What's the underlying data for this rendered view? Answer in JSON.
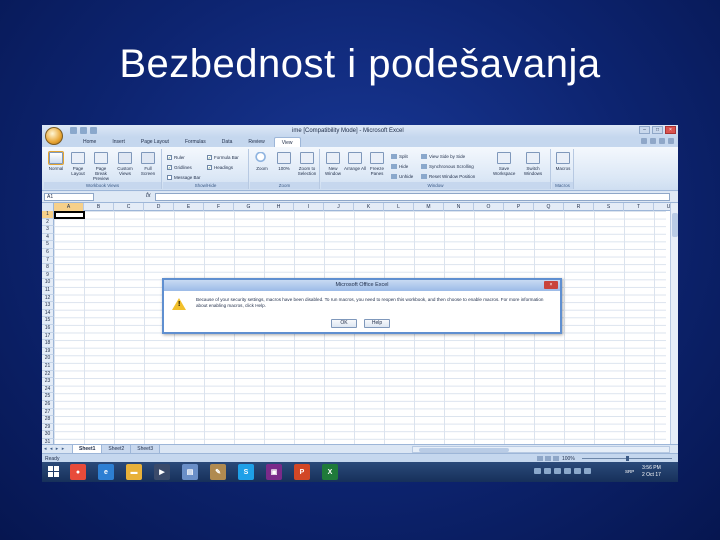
{
  "slide": {
    "title": "Bezbednost i podešavanja"
  },
  "window": {
    "title": "ime  [Compatibility Mode]  -  Microsoft Excel",
    "controls": [
      "–",
      "□",
      "×"
    ]
  },
  "ribbon": {
    "tabs": [
      {
        "label": "Home"
      },
      {
        "label": "Insert"
      },
      {
        "label": "Page Layout"
      },
      {
        "label": "Formulas"
      },
      {
        "label": "Data"
      },
      {
        "label": "Review"
      },
      {
        "label": "View",
        "active": true
      }
    ],
    "groups": {
      "workbook_views": {
        "label": "Workbook Views",
        "buttons": [
          "Normal",
          "Page Layout",
          "Page Break Preview",
          "Custom Views",
          "Full Screen"
        ]
      },
      "show_hide": {
        "label": "Show/Hide",
        "checks": [
          {
            "label": "Ruler",
            "checked": true
          },
          {
            "label": "Gridlines",
            "checked": true
          },
          {
            "label": "Message Bar",
            "checked": false
          },
          {
            "label": "Formula Bar",
            "checked": true
          },
          {
            "label": "Headings",
            "checked": true
          }
        ]
      },
      "zoom": {
        "label": "Zoom",
        "buttons": [
          "Zoom",
          "100%",
          "Zoom to Selection"
        ]
      },
      "window": {
        "label": "Window",
        "buttons": [
          "New Window",
          "Arrange All",
          "Freeze Panes"
        ],
        "small": [
          "Split",
          "Hide",
          "Unhide",
          "View Side by Side",
          "Synchronous Scrolling",
          "Reset Window Position"
        ],
        "big": [
          "Save Workspace",
          "Switch Windows"
        ]
      },
      "macros": {
        "label": "Macros",
        "buttons": [
          "Macros"
        ]
      }
    }
  },
  "formula_bar": {
    "name_box": "A1",
    "fx": "fx",
    "value": ""
  },
  "grid": {
    "columns": [
      "A",
      "B",
      "C",
      "D",
      "E",
      "F",
      "G",
      "H",
      "I",
      "J",
      "K",
      "L",
      "M",
      "N",
      "O",
      "P",
      "Q",
      "R",
      "S",
      "T",
      "U"
    ],
    "rows": [
      "1",
      "2",
      "3",
      "4",
      "5",
      "6",
      "7",
      "8",
      "9",
      "10",
      "11",
      "12",
      "13",
      "14",
      "15",
      "16",
      "17",
      "18",
      "19",
      "20",
      "21",
      "22",
      "23",
      "24",
      "25",
      "26",
      "27",
      "28",
      "29",
      "30",
      "31"
    ],
    "active_cell": "A1"
  },
  "sheets": {
    "nav": "◂ ◂ ▸ ▸",
    "tabs": [
      {
        "label": "Sheet1",
        "active": true
      },
      {
        "label": "Sheet2"
      },
      {
        "label": "Sheet3"
      }
    ]
  },
  "status": {
    "text": "Ready",
    "zoom": "100%"
  },
  "dialog": {
    "title": "Microsoft Office Excel",
    "close": "×",
    "message": "Because of your security settings, macros have been disabled. To run macros, you need to reopen this workbook, and then choose to enable macros. For more information about enabling macros, click Help.",
    "ok": "OK",
    "help": "Help"
  },
  "taskbar": {
    "apps": [
      {
        "name": "chrome-icon",
        "color": "#e84b3a",
        "glyph": "●"
      },
      {
        "name": "ie-icon",
        "color": "#2d7fd3",
        "glyph": "e"
      },
      {
        "name": "folder-icon",
        "color": "#e8b13a",
        "glyph": "▬"
      },
      {
        "name": "media-icon",
        "color": "#3a4a6a",
        "glyph": "▶"
      },
      {
        "name": "presentation-icon",
        "color": "#6a8fc8",
        "glyph": "▤"
      },
      {
        "name": "paint-icon",
        "color": "#b08a50",
        "glyph": "✎"
      },
      {
        "name": "skype-icon",
        "color": "#1ea0e8",
        "glyph": "S"
      },
      {
        "name": "save-icon",
        "color": "#7a2a8a",
        "glyph": "▣"
      },
      {
        "name": "powerpoint-icon",
        "color": "#d24726",
        "glyph": "P"
      },
      {
        "name": "excel-icon",
        "color": "#1f7a3a",
        "glyph": "X"
      }
    ],
    "lang": "SRP",
    "time": "3:56 PM",
    "date": "2 Oct 17"
  }
}
